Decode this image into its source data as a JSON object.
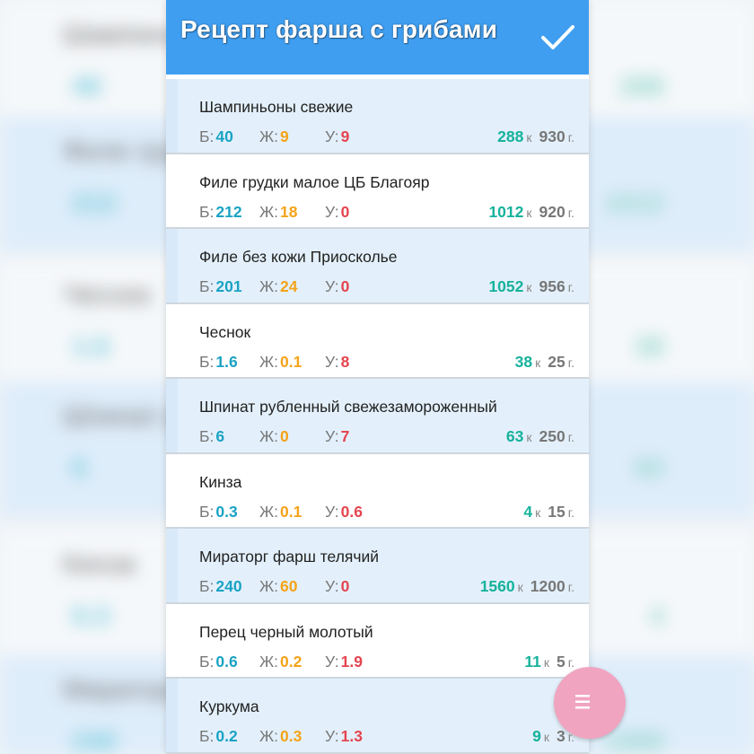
{
  "app": {
    "title": "Рецепт фарша с грибами",
    "confirm_icon": "checkmark-icon",
    "fab_icon": "menu-lines-icon"
  },
  "colors": {
    "appbar": "#3f9ef0",
    "row_alt": "#e3f0fb",
    "protein": "#1aa3c4",
    "fat": "#f4a31a",
    "carbs": "#e5454f",
    "kcal": "#16b29c",
    "fab": "#f0a4c0"
  },
  "labels": {
    "protein": "Б:",
    "fat": "Ж:",
    "carbs": "У:",
    "kcal_unit": "к",
    "weight_unit": "г."
  },
  "items": [
    {
      "name": "Шампиньоны свежие",
      "protein": "40",
      "fat": "9",
      "carbs": "9",
      "kcal": "288",
      "weight": "930"
    },
    {
      "name": "Филе грудки малое ЦБ Благояр",
      "protein": "212",
      "fat": "18",
      "carbs": "0",
      "kcal": "1012",
      "weight": "920"
    },
    {
      "name": "Филе без кожи Приосколье",
      "protein": "201",
      "fat": "24",
      "carbs": "0",
      "kcal": "1052",
      "weight": "956"
    },
    {
      "name": "Чеснок",
      "protein": "1.6",
      "fat": "0.1",
      "carbs": "8",
      "kcal": "38",
      "weight": "25"
    },
    {
      "name": "Шпинат рубленный свежезамороженный",
      "protein": "6",
      "fat": "0",
      "carbs": "7",
      "kcal": "63",
      "weight": "250"
    },
    {
      "name": "Кинза",
      "protein": "0.3",
      "fat": "0.1",
      "carbs": "0.6",
      "kcal": "4",
      "weight": "15"
    },
    {
      "name": "Мираторг фарш телячий",
      "protein": "240",
      "fat": "60",
      "carbs": "0",
      "kcal": "1560",
      "weight": "1200"
    },
    {
      "name": "Перец черный молотый",
      "protein": "0.6",
      "fat": "0.2",
      "carbs": "1.9",
      "kcal": "11",
      "weight": "5"
    },
    {
      "name": "Куркума",
      "protein": "0.2",
      "fat": "0.3",
      "carbs": "1.3",
      "kcal": "9",
      "weight": "3"
    }
  ]
}
